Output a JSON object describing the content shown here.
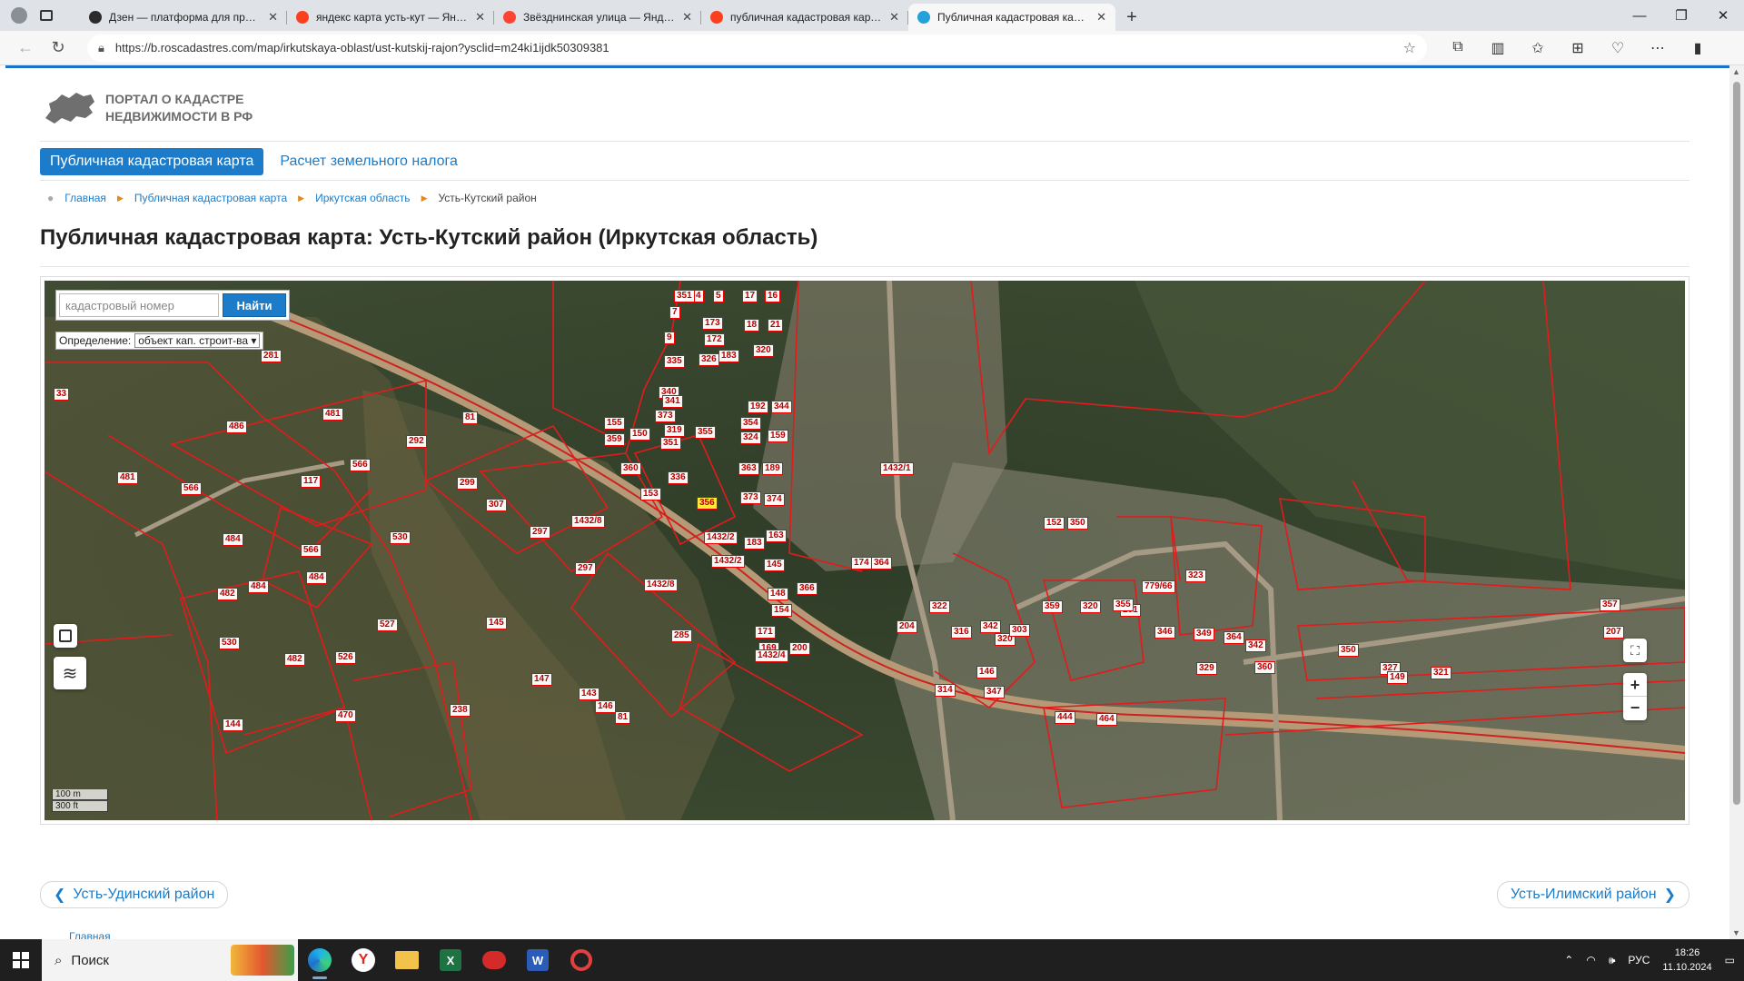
{
  "browser": {
    "tabs": [
      {
        "title": "Дзен — платформа для просмотра",
        "color": "#2b2b2b"
      },
      {
        "title": "яндекс карта усть-кут — Яндекс",
        "color": "#fc3f1d"
      },
      {
        "title": "Звёзднинская улица — Яндекс Ка",
        "color": "#ff4433"
      },
      {
        "title": "публичная кадастровая карта ус",
        "color": "#fc3f1d"
      },
      {
        "title": "Публичная кадастровая карта: У",
        "color": "#22a2d8"
      }
    ],
    "url": "https://b.roscadastres.com/map/irkutskaya-oblast/ust-kutskij-rajon?ysclid=m24ki1ijdk50309381"
  },
  "site": {
    "logo_line1": "ПОРТАЛ О КАДАСТРЕ",
    "logo_line2": "НЕДВИЖИМОСТИ В РФ",
    "menu_active": "Публичная кадастровая карта",
    "menu_link": "Расчет земельного налога"
  },
  "breadcrumbs": {
    "home": "Главная",
    "map": "Публичная кадастровая карта",
    "region": "Иркутская область",
    "current": "Усть-Кутский район"
  },
  "page_title": "Публичная кадастровая карта: Усть-Кутский район (Иркутская область)",
  "map": {
    "search_placeholder": "кадастровый номер",
    "search_button": "Найти",
    "definition_label": "Определение:",
    "definition_value": "объект кап. строит-ва",
    "scale_m": "100 m",
    "scale_ft": "300 ft",
    "zoom_in": "+",
    "zoom_out": "−",
    "parcels": [
      "6",
      "4",
      "5",
      "17",
      "16",
      "7",
      "173",
      "18",
      "21",
      "9",
      "172",
      "281",
      "335",
      "326",
      "183",
      "320",
      "340",
      "341",
      "373",
      "192",
      "344",
      "354",
      "155",
      "150",
      "319",
      "355",
      "351",
      "324",
      "159",
      "359",
      "360",
      "363",
      "189",
      "336",
      "153",
      "356",
      "373",
      "374",
      "1432/2",
      "1432/2",
      "183",
      "163",
      "145",
      "148",
      "154",
      "200",
      "171",
      "169",
      "366",
      "174",
      "364",
      "297",
      "297",
      "1432/8",
      "1432/8",
      "285",
      "307",
      "299",
      "292",
      "481",
      "486",
      "117",
      "566",
      "566",
      "484",
      "482",
      "482",
      "484",
      "566",
      "484",
      "530",
      "530",
      "527",
      "526",
      "470",
      "238",
      "144",
      "145",
      "147",
      "143",
      "146",
      "81",
      "81",
      "1432/4",
      "779/66",
      "323",
      "322",
      "342",
      "320",
      "204",
      "359",
      "320",
      "201",
      "355",
      "346",
      "349",
      "364",
      "342",
      "360",
      "350",
      "327",
      "321",
      "329",
      "149",
      "146",
      "347",
      "314",
      "303",
      "316",
      "444",
      "464",
      "357",
      "207",
      "33",
      "481",
      "1432/1",
      "152",
      "350",
      "351"
    ]
  },
  "pager": {
    "prev": "Усть-Удинский район",
    "next": "Усть-Илимский район"
  },
  "taskbar": {
    "search": "Поиск",
    "lang": "РУС",
    "time": "18:26",
    "date": "11.10.2024"
  }
}
